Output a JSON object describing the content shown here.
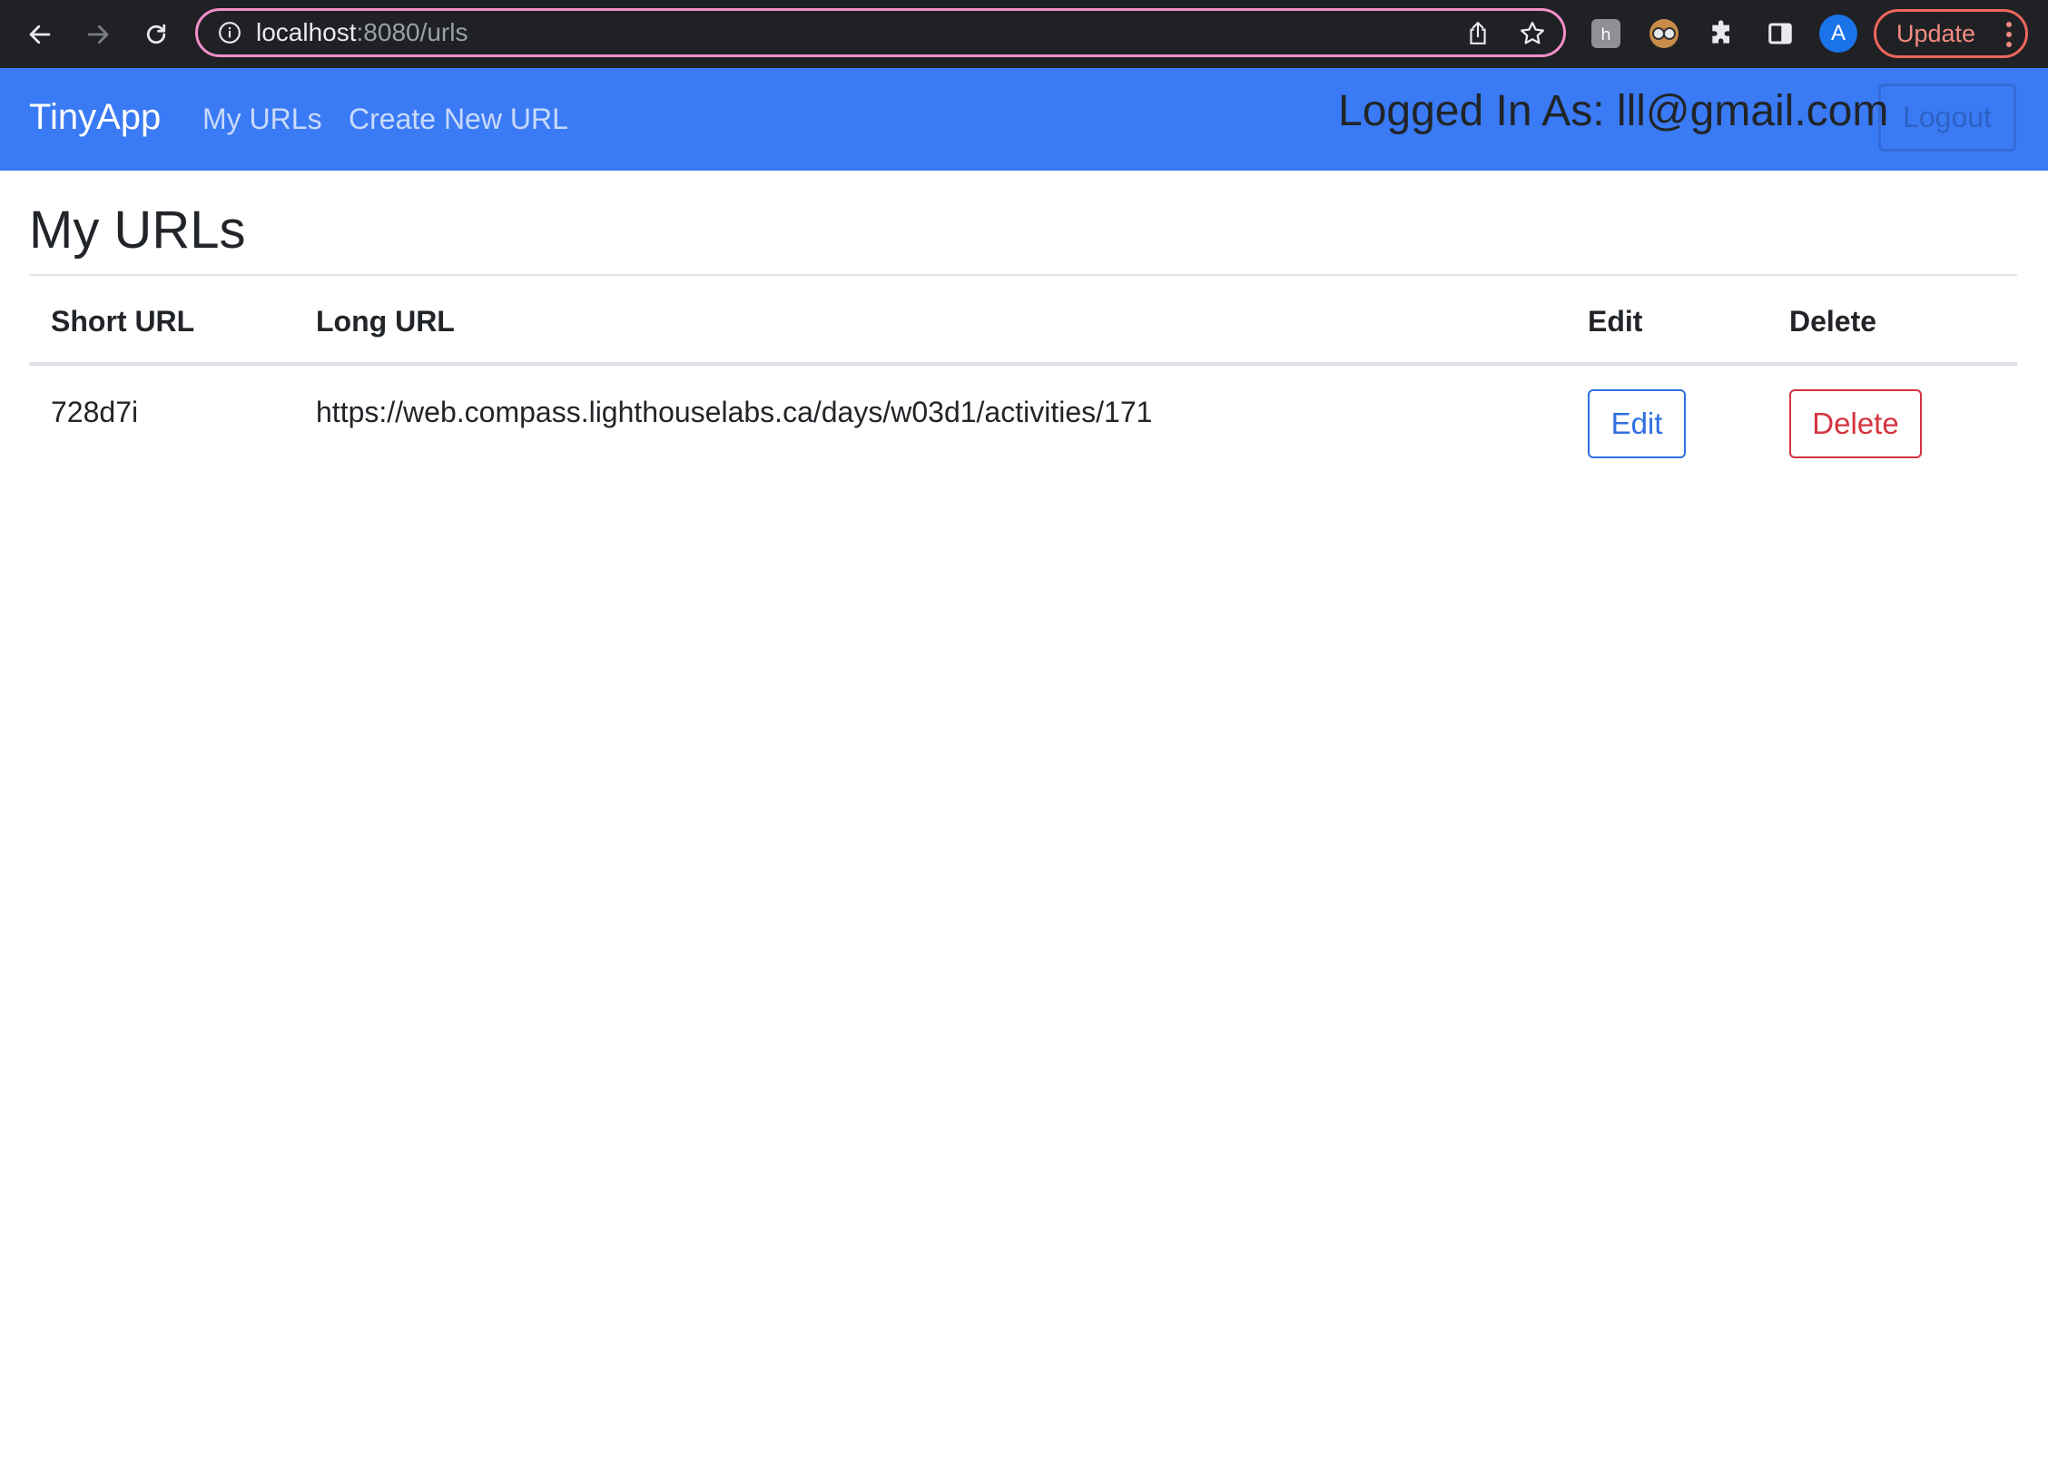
{
  "browser": {
    "url_host": "localhost",
    "url_rest": ":8080/urls",
    "profile_initial": "A",
    "update_label": "Update"
  },
  "navbar": {
    "brand": "TinyApp",
    "links": [
      "My URLs",
      "Create New URL"
    ],
    "logged_in_text": "Logged In As: lll@gmail.com",
    "logout_label": "Logout"
  },
  "main": {
    "title": "My URLs",
    "columns": [
      "Short URL",
      "Long URL",
      "Edit",
      "Delete"
    ],
    "rows": [
      {
        "short_url": "728d7i",
        "long_url": "https://web.compass.lighthouselabs.ca/days/w03d1/activities/171",
        "edit_label": "Edit",
        "delete_label": "Delete"
      }
    ]
  },
  "colors": {
    "navbar_bg": "#3a7af5",
    "edit_accent": "#2f6fe0",
    "delete_accent": "#d4343f",
    "chrome_bg": "#202124"
  }
}
